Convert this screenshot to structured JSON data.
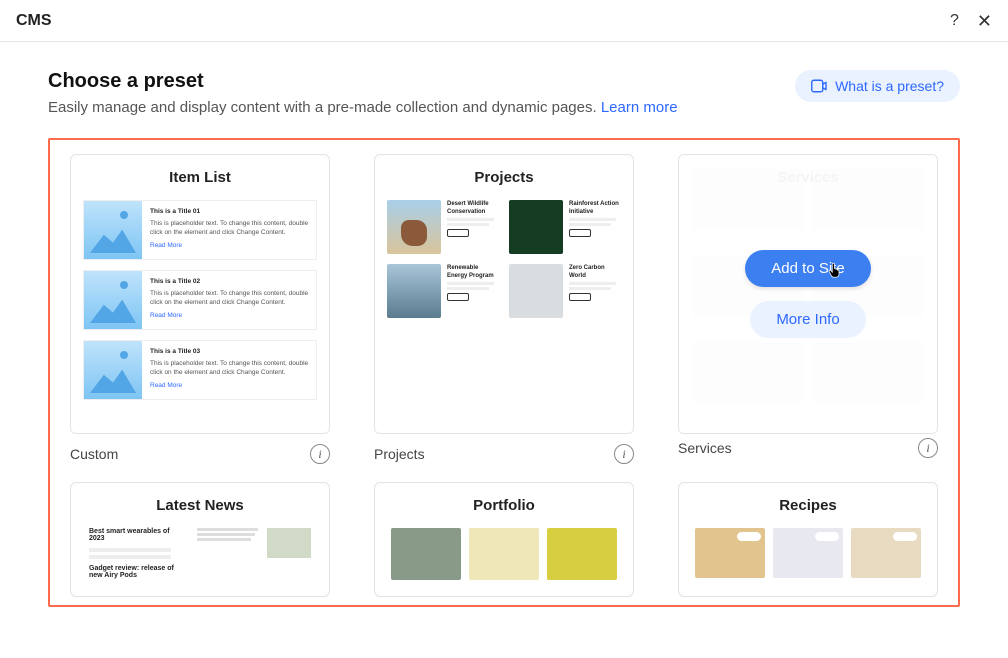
{
  "topbar": {
    "title": "CMS"
  },
  "header": {
    "title": "Choose a preset",
    "subtitle": "Easily manage and display content with a pre-made collection and dynamic pages. ",
    "learn_more": "Learn more",
    "what_is_preset": "What is a preset?"
  },
  "presets": [
    {
      "preview_title": "Item List",
      "label": "Custom",
      "hovered": false,
      "items": [
        {
          "title": "This is a Title 01",
          "desc": "This is placeholder text. To change this content, double click on the element and click Change Content.",
          "read_more": "Read More"
        },
        {
          "title": "This is a Title 02",
          "desc": "This is placeholder text. To change this content, double click on the element and click Change Content.",
          "read_more": "Read More"
        },
        {
          "title": "This is a Title 03",
          "desc": "This is placeholder text. To change this content, double click on the element and click Change Content.",
          "read_more": "Read More"
        }
      ]
    },
    {
      "preview_title": "Projects",
      "label": "Projects",
      "hovered": false,
      "cells": [
        {
          "title": "Desert Wildlife Conservation"
        },
        {
          "title": "Rainforest Action Initiative"
        },
        {
          "title": "Renewable Energy Program"
        },
        {
          "title": "Zero Carbon World"
        }
      ]
    },
    {
      "preview_title": "Services",
      "label": "Services",
      "hovered": true,
      "add_to_site": "Add to Site",
      "more_info": "More Info"
    },
    {
      "preview_title": "Latest News",
      "label": "",
      "hovered": false,
      "news": {
        "left": [
          {
            "t": "Best smart wearables of 2023"
          },
          {
            "t": "Gadget review: release of new Airy Pods"
          }
        ]
      }
    },
    {
      "preview_title": "Portfolio",
      "label": "",
      "hovered": false
    },
    {
      "preview_title": "Recipes",
      "label": "",
      "hovered": false
    }
  ]
}
